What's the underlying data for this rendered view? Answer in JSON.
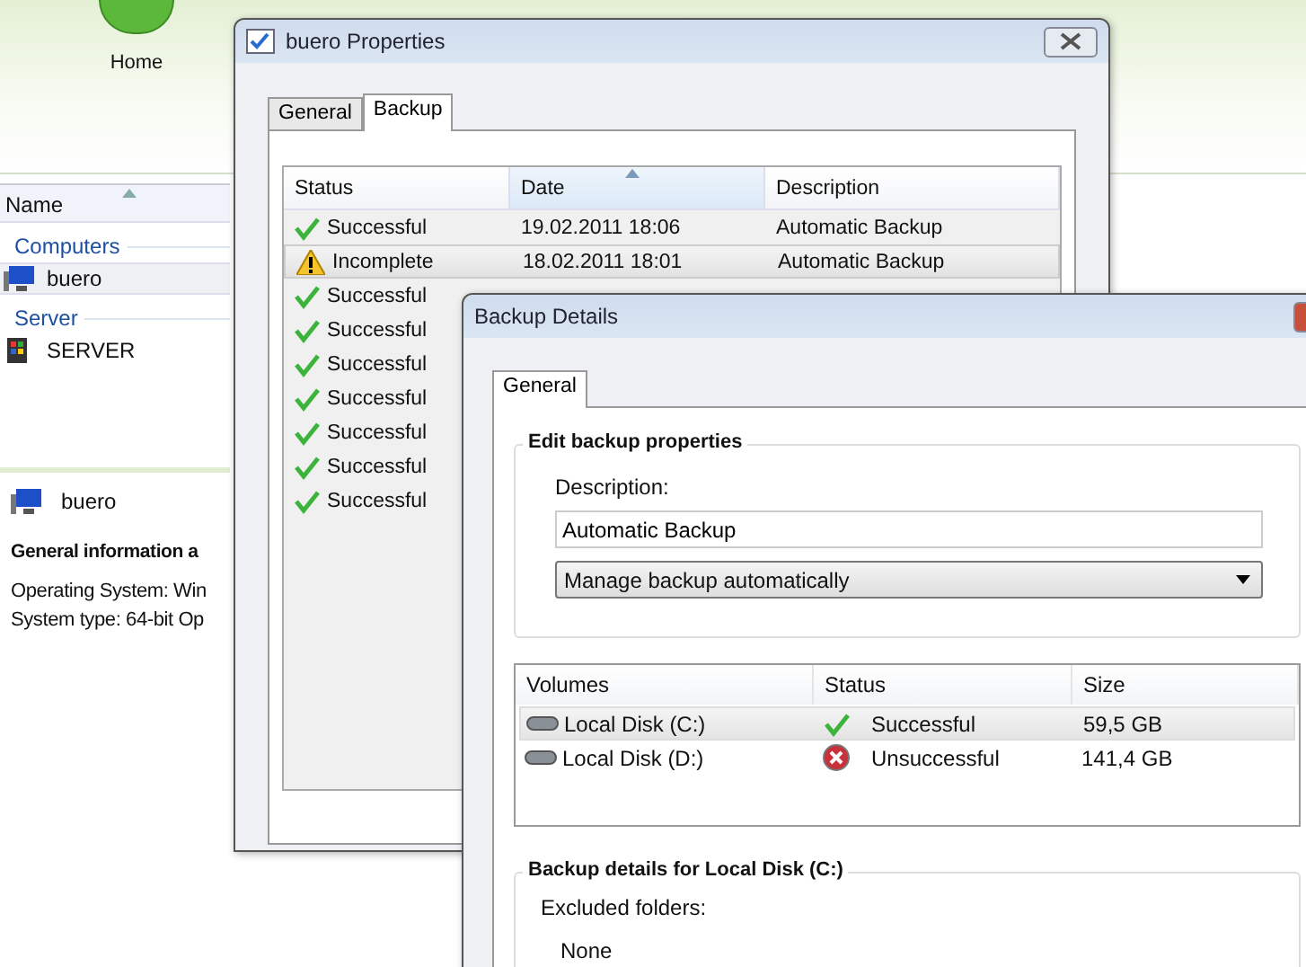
{
  "app": {
    "ribbon": {
      "home_label": "Home"
    },
    "list": {
      "column": {
        "label": "Name",
        "sorted": true
      },
      "groups": [
        {
          "title": "Computers",
          "items": [
            {
              "label": "buero",
              "kind": "computer",
              "selected": true
            }
          ]
        },
        {
          "title": "Server",
          "items": [
            {
              "label": "SERVER",
              "kind": "server",
              "selected": false
            }
          ]
        }
      ]
    },
    "details": {
      "title": "buero",
      "heading": "General information a",
      "lines": [
        "Operating System: Win",
        "System type: 64-bit Op"
      ]
    }
  },
  "properties_window": {
    "title": "buero Properties",
    "tabs": [
      {
        "label": "General",
        "selected": false
      },
      {
        "label": "Backup",
        "selected": true
      }
    ],
    "columns": [
      {
        "label": "Status",
        "sorted": false
      },
      {
        "label": "Date",
        "sorted": true
      },
      {
        "label": "Description",
        "sorted": false
      }
    ],
    "rows": [
      {
        "status": "Successful",
        "kind": "success",
        "date": "19.02.2011 18:06",
        "description": "Automatic Backup",
        "selected": false
      },
      {
        "status": "Incomplete",
        "kind": "warning",
        "date": "18.02.2011 18:01",
        "description": "Automatic Backup",
        "selected": true
      },
      {
        "status": "Successful",
        "kind": "success",
        "selected": false
      },
      {
        "status": "Successful",
        "kind": "success",
        "selected": false
      },
      {
        "status": "Successful",
        "kind": "success",
        "selected": false
      },
      {
        "status": "Successful",
        "kind": "success",
        "selected": false
      },
      {
        "status": "Successful",
        "kind": "success",
        "selected": false
      },
      {
        "status": "Successful",
        "kind": "success",
        "selected": false
      },
      {
        "status": "Successful",
        "kind": "success",
        "selected": false
      }
    ]
  },
  "details_window": {
    "title": "Backup Details",
    "tabs": [
      {
        "label": "General",
        "selected": true
      }
    ],
    "edit_group": {
      "title": "Edit backup properties",
      "description_label": "Description:",
      "description_value": "Automatic Backup",
      "mode": "Manage backup automatically"
    },
    "volume_columns": [
      "Volumes",
      "Status",
      "Size"
    ],
    "volumes": [
      {
        "name": "Local Disk (C:)",
        "status": "Successful",
        "kind": "success",
        "size": "59,5 GB",
        "selected": true
      },
      {
        "name": "Local Disk (D:)",
        "status": "Unsuccessful",
        "kind": "error",
        "size": "141,4 GB",
        "selected": false
      }
    ],
    "details_group": {
      "title": "Backup details for Local Disk (C:)",
      "label": "Excluded folders:",
      "value": "None"
    }
  }
}
